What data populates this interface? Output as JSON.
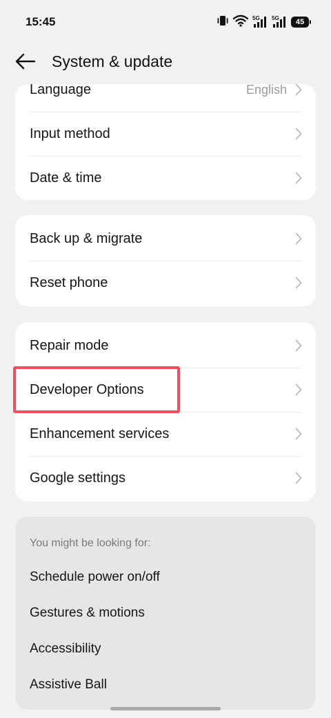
{
  "status": {
    "time": "15:45",
    "net1": "5G",
    "net2": "5G",
    "battery": "45"
  },
  "header": {
    "title": "System & update"
  },
  "groups": [
    {
      "items": [
        {
          "label": "Language",
          "value": "English"
        },
        {
          "label": "Input method"
        },
        {
          "label": "Date & time"
        }
      ]
    },
    {
      "items": [
        {
          "label": "Back up & migrate"
        },
        {
          "label": "Reset phone"
        }
      ]
    },
    {
      "items": [
        {
          "label": "Repair mode"
        },
        {
          "label": "Developer Options"
        },
        {
          "label": "Enhancement services"
        },
        {
          "label": "Google settings"
        }
      ]
    }
  ],
  "suggestions": {
    "heading": "You might be looking for:",
    "items": [
      "Schedule power on/off",
      "Gestures & motions",
      "Accessibility",
      "Assistive Ball"
    ]
  },
  "colors": {
    "highlight": "#f0505a",
    "background": "#f1f1f3"
  }
}
